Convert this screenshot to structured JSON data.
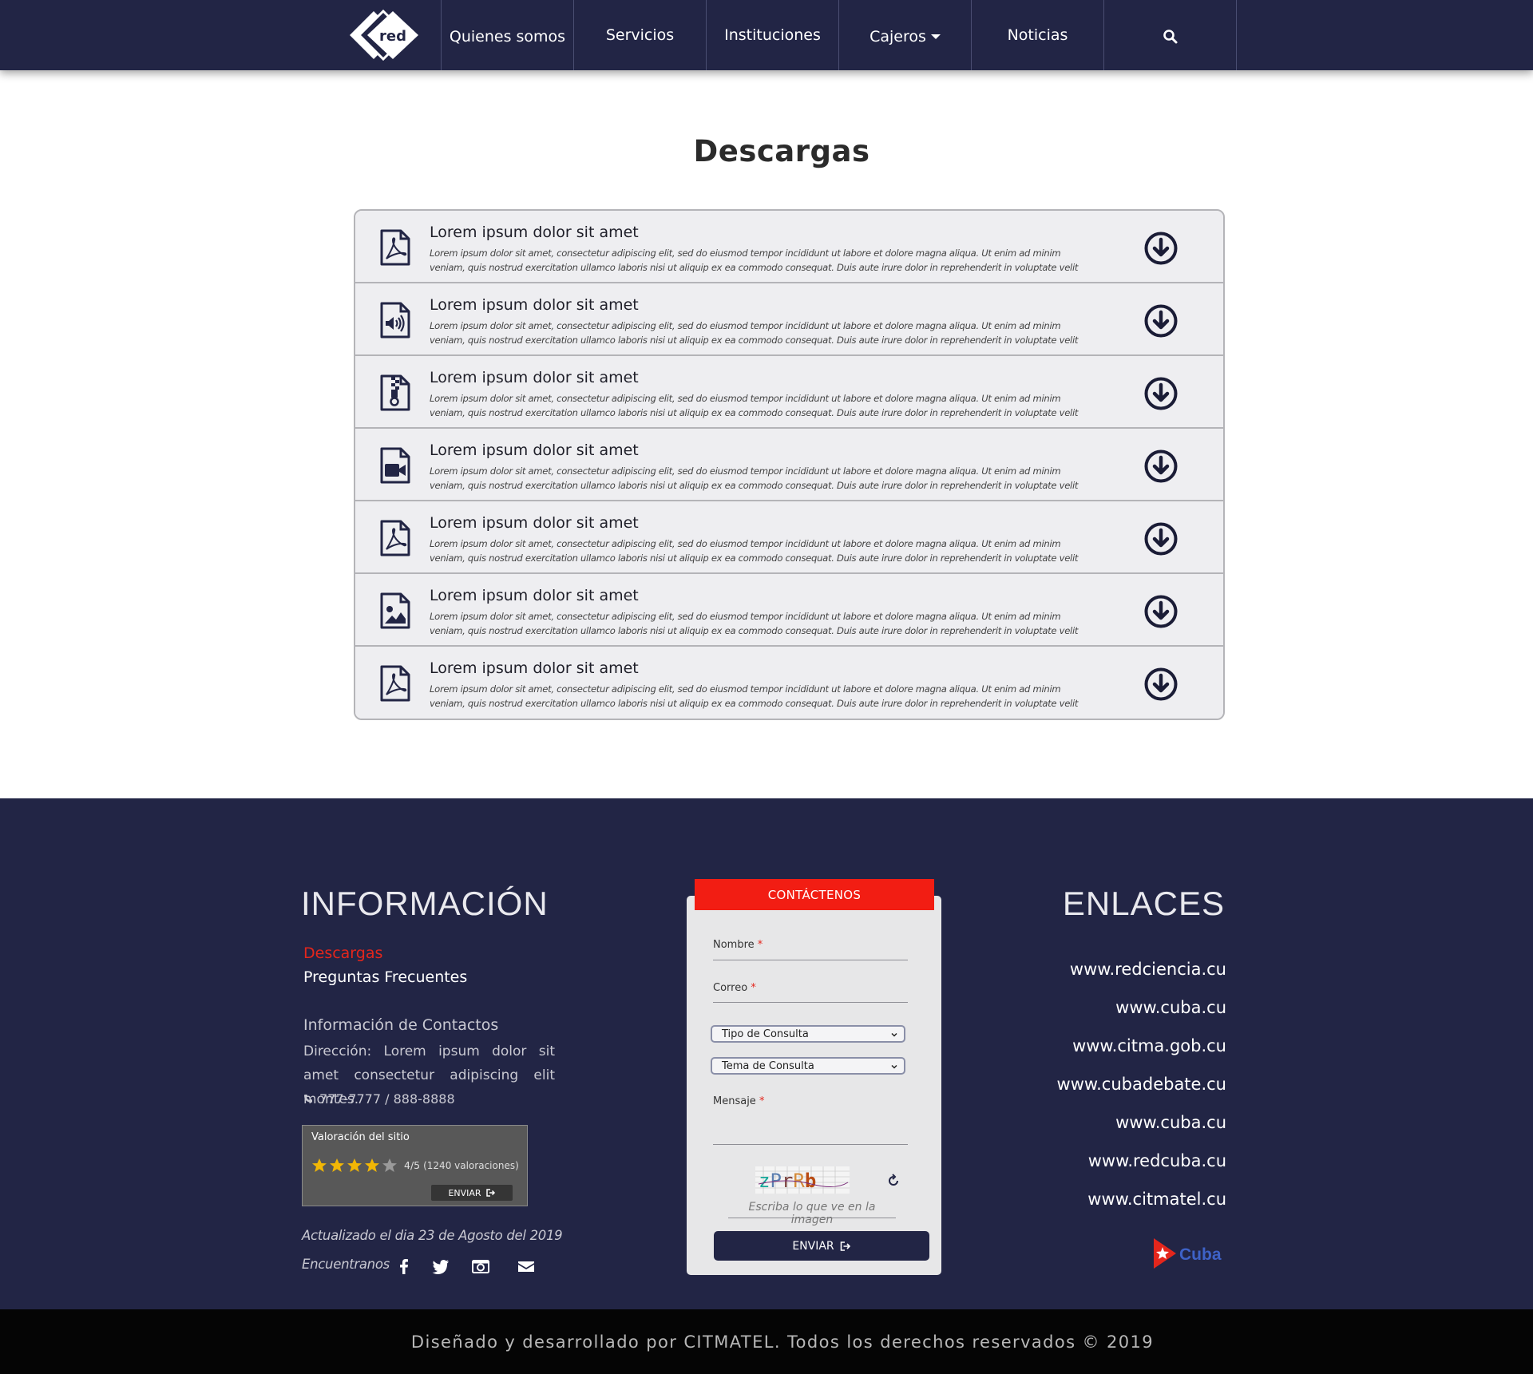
{
  "nav": {
    "logo_text": "red",
    "items": [
      {
        "label": "Quienes somos"
      },
      {
        "label": "Servicios"
      },
      {
        "label": "Instituciones"
      },
      {
        "label": "Cajeros"
      },
      {
        "label": "Noticias"
      }
    ],
    "search_icon": "search-icon"
  },
  "main": {
    "title": "Descargas",
    "downloads": [
      {
        "icon": "pdf-file-icon",
        "title": "Lorem ipsum dolor sit amet",
        "description": "Lorem ipsum dolor sit amet, consectetur adipiscing elit, sed do eiusmod tempor incididunt ut labore et dolore magna aliqua. Ut enim ad minim veniam, quis nostrud exercitation ullamco laboris nisi ut aliquip ex ea commodo consequat. Duis aute irure dolor in reprehenderit in voluptate velit esse cillum dolore eu"
      },
      {
        "icon": "audio-file-icon",
        "title": "Lorem ipsum dolor sit amet",
        "description": "Lorem ipsum dolor sit amet, consectetur adipiscing elit, sed do eiusmod tempor incididunt ut labore et dolore magna aliqua. Ut enim ad minim veniam, quis nostrud exercitation ullamco laboris nisi ut aliquip ex ea commodo consequat. Duis aute irure dolor in reprehenderit in voluptate velit esse cillum dolore eu"
      },
      {
        "icon": "zip-file-icon",
        "title": "Lorem ipsum dolor sit amet",
        "description": "Lorem ipsum dolor sit amet, consectetur adipiscing elit, sed do eiusmod tempor incididunt ut labore et dolore magna aliqua. Ut enim ad minim veniam, quis nostrud exercitation ullamco laboris nisi ut aliquip ex ea commodo consequat. Duis aute irure dolor in reprehenderit in voluptate velit esse cillum dolore eu"
      },
      {
        "icon": "video-file-icon",
        "title": "Lorem ipsum dolor sit amet",
        "description": "Lorem ipsum dolor sit amet, consectetur adipiscing elit, sed do eiusmod tempor incididunt ut labore et dolore magna aliqua. Ut enim ad minim veniam, quis nostrud exercitation ullamco laboris nisi ut aliquip ex ea commodo consequat. Duis aute irure dolor in reprehenderit in voluptate velit esse cillum dolore eu"
      },
      {
        "icon": "pdf-file-icon",
        "title": "Lorem ipsum dolor sit amet",
        "description": "Lorem ipsum dolor sit amet, consectetur adipiscing elit, sed do eiusmod tempor incididunt ut labore et dolore magna aliqua. Ut enim ad minim veniam, quis nostrud exercitation ullamco laboris nisi ut aliquip ex ea commodo consequat. Duis aute irure dolor in reprehenderit in voluptate velit esse cillum dolore eu"
      },
      {
        "icon": "image-file-icon",
        "title": "Lorem ipsum dolor sit amet",
        "description": "Lorem ipsum dolor sit amet, consectetur adipiscing elit, sed do eiusmod tempor incididunt ut labore et dolore magna aliqua. Ut enim ad minim veniam, quis nostrud exercitation ullamco laboris nisi ut aliquip ex ea commodo consequat. Duis aute irure dolor in reprehenderit in voluptate velit esse cillum dolore eu"
      },
      {
        "icon": "pdf-file-icon",
        "title": "Lorem ipsum dolor sit amet",
        "description": "Lorem ipsum dolor sit amet, consectetur adipiscing elit, sed do eiusmod tempor incididunt ut labore et dolore magna aliqua. Ut enim ad minim veniam, quis nostrud exercitation ullamco laboris nisi ut aliquip ex ea commodo consequat. Duis aute irure dolor in reprehenderit in voluptate velit esse cillum dolore eu"
      }
    ]
  },
  "footer": {
    "info_heading": "INFORMACIÓN",
    "link_downloads": "Descargas",
    "link_faq": "Preguntas Frecuentes",
    "contact_heading": "Información de Contactos",
    "address": "Dirección: Lorem ipsum dolor sit amet consectetur adipiscing elit montes.",
    "phone": "777-7777 / 888-8888",
    "rating": {
      "title": "Valoración del sitio",
      "stars": 4,
      "max_stars": 5,
      "score": "4/5",
      "count": "(1240 valoraciones)",
      "send_label": "ENVIAR"
    },
    "updated": "Actualizado el dia 23 de Agosto del 2019",
    "find_us": "Encuentranos",
    "social_icons": [
      "facebook-icon",
      "twitter-icon",
      "camera-icon",
      "envelope-icon"
    ],
    "contact_form": {
      "tab_label": "CONTÁCTENOS",
      "name_label": "Nombre",
      "email_label": "Correo",
      "required_mark": "*",
      "type_select": "Tipo de Consulta",
      "topic_select": "Tema de Consulta",
      "message_label": "Mensaje",
      "captcha_text": "zPrRb",
      "captcha_placeholder": "Escriba lo que ve en la imagen",
      "send_label": "ENVIAR"
    },
    "links_heading": "ENLACES",
    "links": [
      "www.redciencia.cu",
      "www.cuba.cu",
      "www.citma.gob.cu",
      "www.cubadebate.cu",
      "www.cuba.cu",
      "www.redcuba.cu",
      "www.citmatel.cu"
    ],
    "cuba_logo_text": "Cuba",
    "copyright": "Diseñado y desarrollado por CITMATEL. Todos los derechos reservados © 2019"
  },
  "colors": {
    "navy": "#222545",
    "accent_red": "#e4261c",
    "form_tab_red": "#f21d13",
    "star_gold": "#f2b705"
  }
}
